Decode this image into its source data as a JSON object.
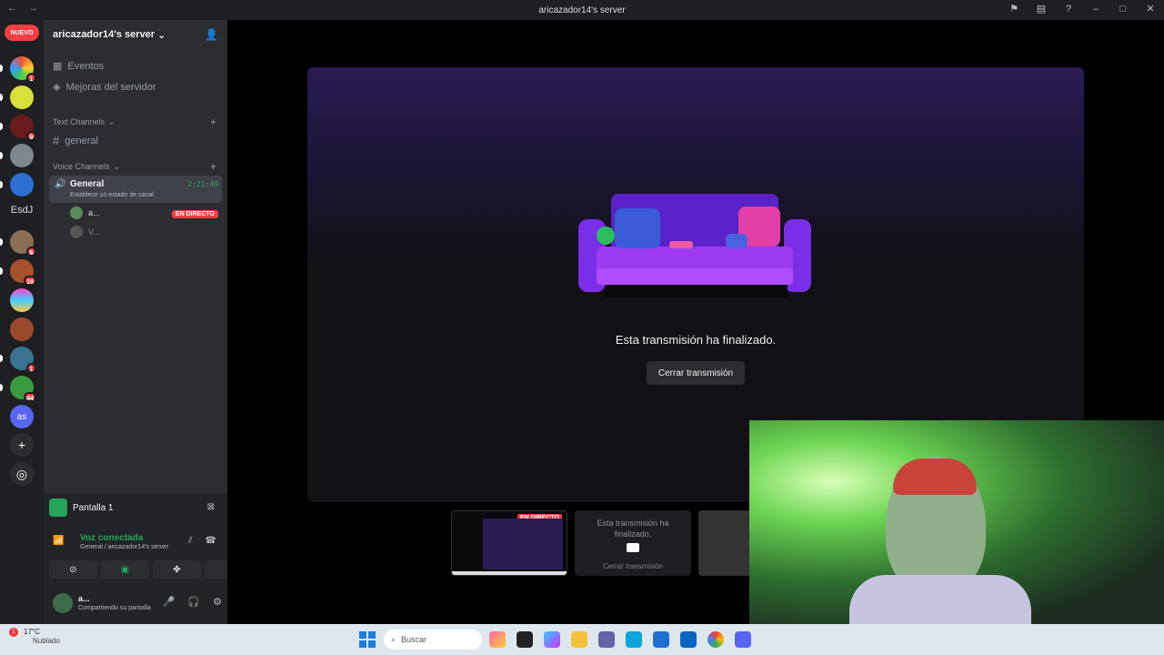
{
  "window": {
    "title": "aricazador14's server"
  },
  "servers": {
    "nuevo_label": "NUEVO",
    "badges": [
      "1",
      "9",
      "6",
      "10",
      "1",
      "44"
    ],
    "esdj": "EsdJ",
    "active_abbr": "as"
  },
  "sidebar": {
    "server_name": "aricazador14's server",
    "events": "Eventos",
    "boosts": "Mejoras del servidor",
    "text_category": "Text Channels",
    "text_channel": "general",
    "voice_category": "Voice Channels",
    "voice_channel": {
      "name": "General",
      "status": "Establece un estado de canal",
      "time": "2:21:49"
    },
    "users": [
      {
        "name": "a...",
        "badge": "EN DIRECTO"
      },
      {
        "name": "V..."
      }
    ]
  },
  "panel": {
    "screen_name": "Pantalla 1",
    "voice_status": "Voz conectada",
    "voice_sub": "General / aricazador14's server",
    "user_name": "a...",
    "user_status": "Compartiendo su pantalla"
  },
  "stage": {
    "message": "Esta transmisión ha finalizado.",
    "close_button": "Cerrar transmisión"
  },
  "thumbs": {
    "live": "EN DIRECTO",
    "ended_message": "Esta transmisión ha finalizado.",
    "ended_close": "Cerrar transmisión"
  },
  "taskbar": {
    "temp": "17°C",
    "weather": "Nublado",
    "weather_badge": "1",
    "search_placeholder": "Buscar"
  },
  "colors": {
    "accent_green": "#23a55a",
    "live_red": "#f23f43",
    "sidebar_bg": "#2b2d31"
  }
}
